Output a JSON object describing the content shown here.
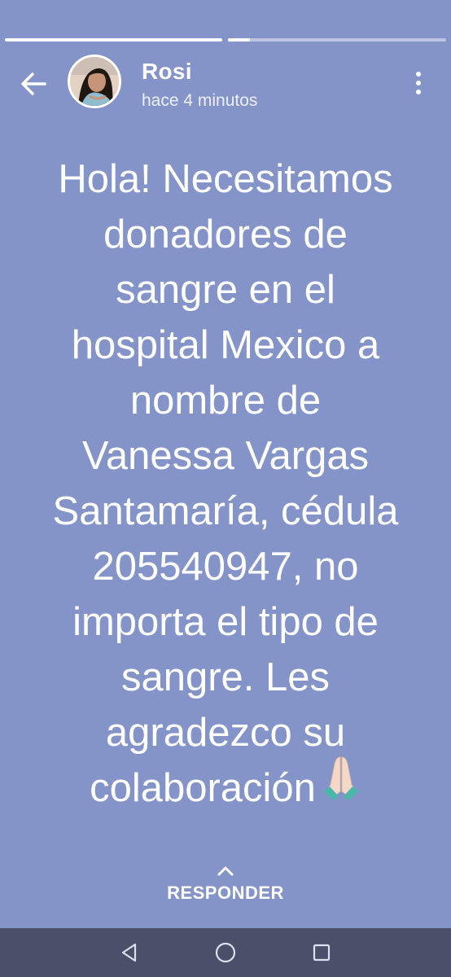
{
  "story": {
    "progress": [
      1.0,
      0.1
    ],
    "author": "Rosi",
    "timestamp": "hace 4 minutos",
    "text": "Hola! Necesitamos\ndonadores de\nsangre en el\nhospital Mexico a\nnombre de\nVanessa Vargas\nSantamaría, cédula\n205540947, no\nimporta el tipo de\nsangre. Les\nagradezco su\ncolaboración",
    "emoji": "folded-hands"
  },
  "reply": {
    "label": "RESPONDER"
  },
  "colors": {
    "background": "#8594c8",
    "navbar": "#4c4f6a",
    "text": "#ffffff"
  }
}
